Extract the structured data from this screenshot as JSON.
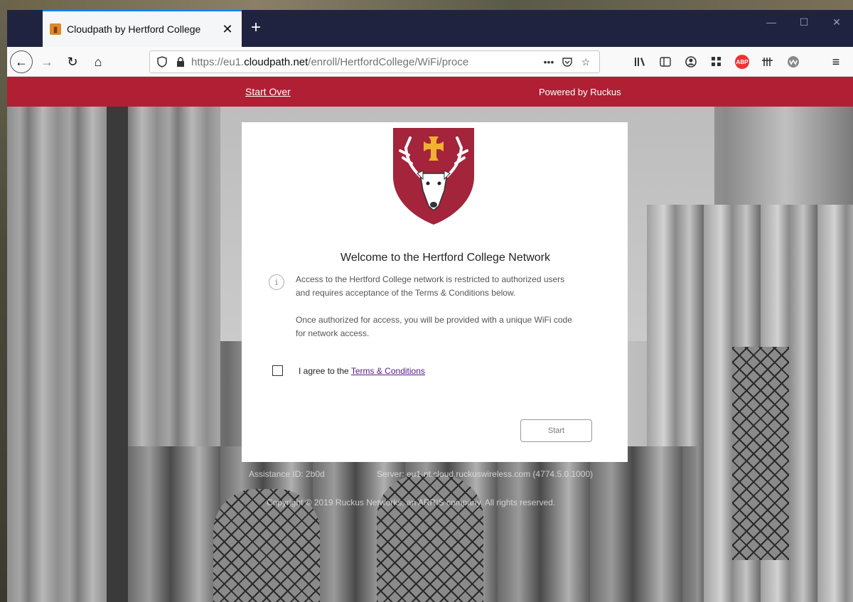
{
  "browser": {
    "tab_title": "Cloudpath by Hertford College",
    "tab_favicon": "cloudpath-favicon",
    "url_prefix": "https://eu1.",
    "url_domain": "cloudpath.net",
    "url_path": "/enroll/HertfordCollege/WiFi/proce",
    "url_more": "•••",
    "win_minimize": "—",
    "win_maximize": "☐",
    "win_close": "✕",
    "new_tab": "+",
    "close_tab": "✕"
  },
  "page": {
    "start_over": "Start Over",
    "powered_by": "Powered by Ruckus",
    "welcome_title": "Welcome to the Hertford College Network",
    "info_p1": "Access to the Hertford College network is restricted to authorized users and requires acceptance of the Terms & Conditions below.",
    "info_p2": "Once authorized for access, you will be provided with a unique WiFi code for network access.",
    "agree_prefix": "I agree to the ",
    "terms_link": "Terms & Conditions",
    "start_button": "Start",
    "footer_assist": "Assistance ID: 2b0d",
    "footer_server": "Server: eu1-nt.cloud.ruckuswireless.com (4774.5.0.1000)",
    "footer_copyright": "Copyright © 2019 Ruckus Networks, an ARRIS company. All rights reserved."
  },
  "colors": {
    "header_red": "#b01f34",
    "crest_red": "#a3243b",
    "crest_gold": "#f0b030",
    "tabbar_bg": "#202340",
    "tab_accent": "#0a84ff"
  }
}
